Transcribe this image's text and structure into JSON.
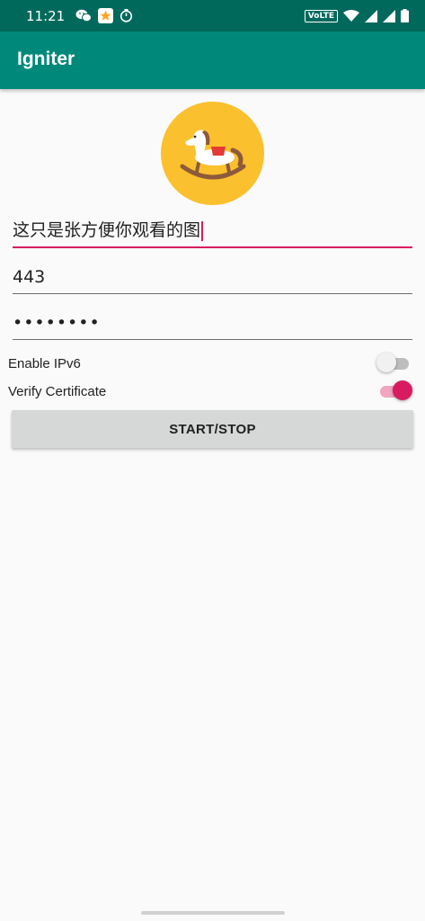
{
  "status_bar": {
    "time": "11:21",
    "volte": "VoLTE",
    "icons_left": [
      "wechat-icon",
      "star-app-icon",
      "timer-icon"
    ],
    "icons_right": [
      "wifi-icon",
      "signal-icon",
      "signal-icon",
      "battery-icon"
    ]
  },
  "app_bar": {
    "title": "Igniter"
  },
  "logo": {
    "icon": "rocking-horse-icon",
    "color": "#fbc02d"
  },
  "form": {
    "server_value": "这只是张方便你观看的图",
    "port_value": "443",
    "password_value": "••••••••"
  },
  "toggles": {
    "ipv6": {
      "label": "Enable IPv6",
      "checked": false
    },
    "verify": {
      "label": "Verify Certificate",
      "checked": true
    }
  },
  "actions": {
    "start_stop_label": "START/STOP"
  },
  "colors": {
    "status_bar": "#00695c",
    "app_bar": "#00897b",
    "accent": "#d81b60",
    "background": "#fafafa"
  }
}
